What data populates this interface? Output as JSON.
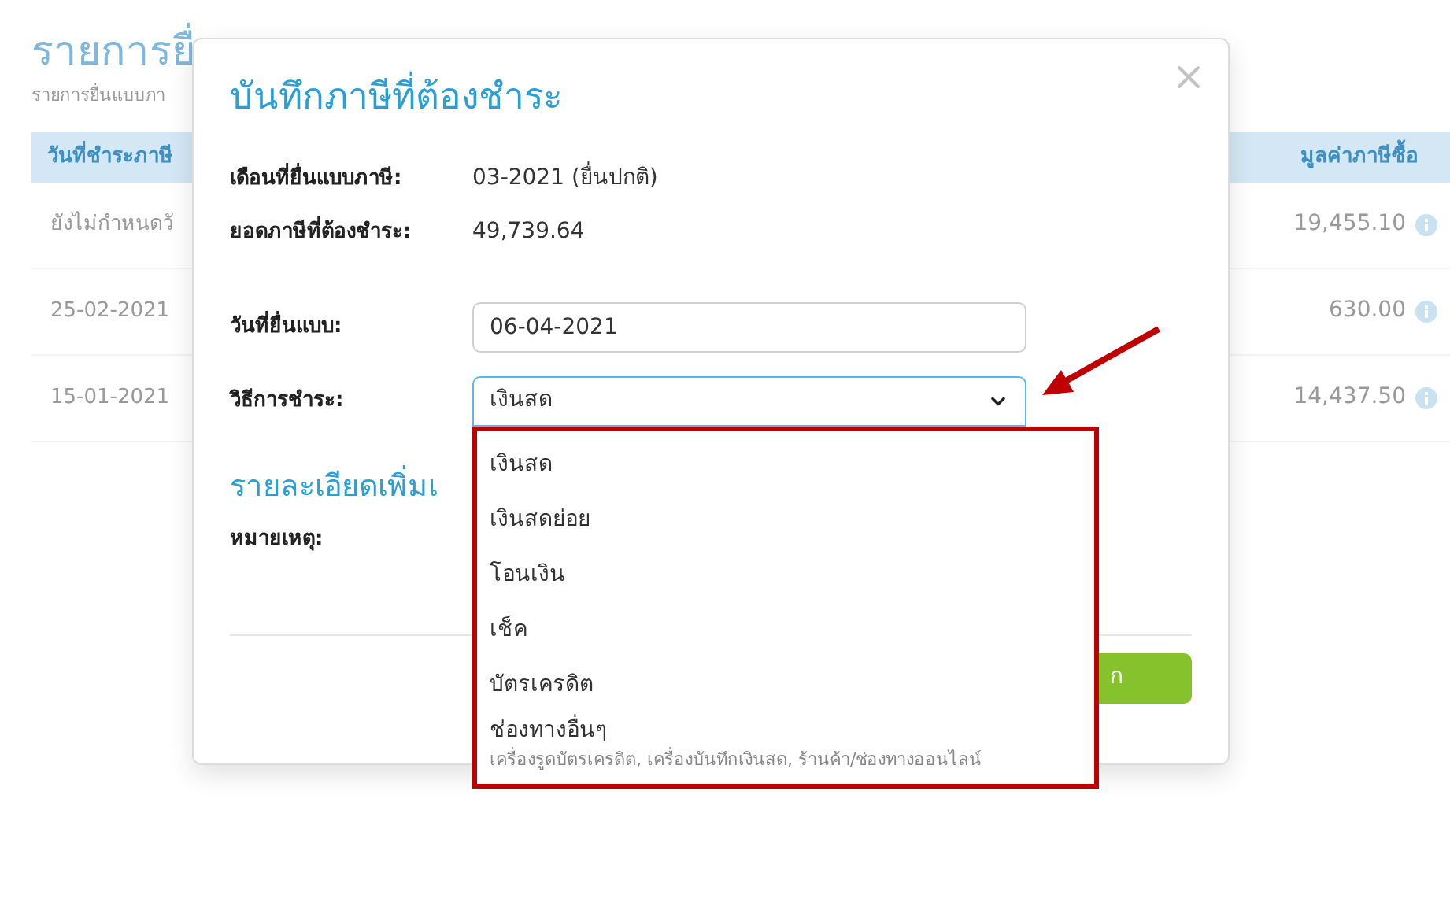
{
  "page": {
    "title": "รายการยื่",
    "subtitle": "รายการยื่นแบบภา"
  },
  "table": {
    "columns": [
      "วันที่ชำระภาษี",
      "มูลค่าภาษีซื้อ"
    ],
    "rows": [
      {
        "date": "ยังไม่กำหนดวั",
        "value": "19,455.10"
      },
      {
        "date": "25-02-2021",
        "value": "630.00"
      },
      {
        "date": "15-01-2021",
        "value": "14,437.50"
      }
    ]
  },
  "dialog": {
    "title": "บันทึกภาษีที่ต้องชำระ",
    "info": [
      {
        "label": "เดือนที่ยื่นแบบภาษี:",
        "value": "03-2021 (ยื่นปกติ)"
      },
      {
        "label": "ยอดภาษีที่ต้องชำระ:",
        "value": "49,739.64"
      }
    ],
    "filing_date": {
      "label": "วันที่ยื่นแบบ:",
      "value": "06-04-2021"
    },
    "payment_method": {
      "label": "วิธีการชำระ:",
      "value": "เงินสด",
      "expanded": true,
      "options": [
        {
          "label": "เงินสด"
        },
        {
          "label": "เงินสดย่อย"
        },
        {
          "label": "โอนเงิน"
        },
        {
          "label": "เช็ค"
        },
        {
          "label": "บัตรเครดิต"
        },
        {
          "label": "ช่องทางอื่นๆ",
          "description": "เครื่องรูดบัตรเครดิต, เครื่องบันทึกเงินสด, ร้านค้า/ช่องทางออนไลน์"
        }
      ]
    },
    "section_title": "รายละเอียดเพิ่มเ",
    "note_label": "หมายเหตุ:",
    "save_button": "ก"
  }
}
